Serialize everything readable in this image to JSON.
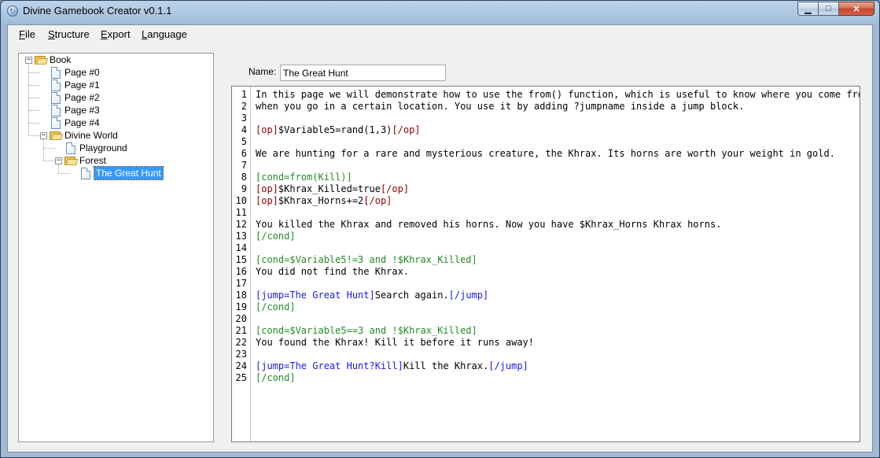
{
  "window": {
    "title": "Divine Gamebook Creator v0.1.1"
  },
  "menu": [
    {
      "ul": "F",
      "rest": "ile"
    },
    {
      "ul": "S",
      "rest": "tructure"
    },
    {
      "ul": "E",
      "rest": "xport"
    },
    {
      "ul": "L",
      "rest": "anguage"
    }
  ],
  "tree": [
    {
      "label": "Book",
      "type": "folder",
      "level": 0,
      "expanded": true
    },
    {
      "label": "Page #0",
      "type": "page",
      "level": 1
    },
    {
      "label": "Page #1",
      "type": "page",
      "level": 1
    },
    {
      "label": "Page #2",
      "type": "page",
      "level": 1
    },
    {
      "label": "Page #3",
      "type": "page",
      "level": 1
    },
    {
      "label": "Page #4",
      "type": "page",
      "level": 1
    },
    {
      "label": "Divine World",
      "type": "folder",
      "level": 1,
      "expanded": true
    },
    {
      "label": "Playground",
      "type": "page",
      "level": 2
    },
    {
      "label": "Forest",
      "type": "folder",
      "level": 2,
      "expanded": true
    },
    {
      "label": "The Great Hunt",
      "type": "page",
      "level": 3,
      "selected": true
    }
  ],
  "name_field": {
    "label": "Name:",
    "value": "The Great Hunt"
  },
  "colors": {
    "text": "#000000",
    "op": "#8b0000",
    "cond": "#228b22",
    "jump": "#1a1ae6"
  },
  "editor": {
    "lines": [
      [
        [
          "text",
          "In this page we will demonstrate how to use the from() function, which is useful to know where you come from"
        ]
      ],
      [
        [
          "text",
          "when you go in a certain location. You use it by adding ?jumpname inside a jump block."
        ]
      ],
      [],
      [
        [
          "op",
          "[op]"
        ],
        [
          "text",
          "$Variable5=rand(1,3)"
        ],
        [
          "op",
          "[/op]"
        ]
      ],
      [],
      [
        [
          "text",
          "We are hunting for a rare and mysterious creature, the Khrax. Its horns are worth your weight in gold."
        ]
      ],
      [],
      [
        [
          "cond",
          "[cond=from(Kill)]"
        ]
      ],
      [
        [
          "op",
          "[op]"
        ],
        [
          "text",
          "$Khrax_Killed=true"
        ],
        [
          "op",
          "[/op]"
        ]
      ],
      [
        [
          "op",
          "[op]"
        ],
        [
          "text",
          "$Khrax_Horns+=2"
        ],
        [
          "op",
          "[/op]"
        ]
      ],
      [],
      [
        [
          "text",
          "You killed the Khrax and removed his horns. Now you have $Khrax_Horns Khrax horns."
        ]
      ],
      [
        [
          "cond",
          "[/cond]"
        ]
      ],
      [],
      [
        [
          "cond",
          "[cond=$Variable5!=3 and !$Khrax_Killed]"
        ]
      ],
      [
        [
          "text",
          "You did not find the Khrax."
        ]
      ],
      [],
      [
        [
          "jump",
          "[jump=The Great Hunt]"
        ],
        [
          "text",
          "Search again."
        ],
        [
          "jump",
          "[/jump]"
        ]
      ],
      [
        [
          "cond",
          "[/cond]"
        ]
      ],
      [],
      [
        [
          "cond",
          "[cond=$Variable5==3 and !$Khrax_Killed]"
        ]
      ],
      [
        [
          "text",
          "You found the Khrax! Kill it before it runs away!"
        ]
      ],
      [],
      [
        [
          "jump",
          "[jump=The Great Hunt?Kill]"
        ],
        [
          "text",
          "Kill the Khrax."
        ],
        [
          "jump",
          "[/jump]"
        ]
      ],
      [
        [
          "cond",
          "[/cond]"
        ]
      ]
    ]
  }
}
